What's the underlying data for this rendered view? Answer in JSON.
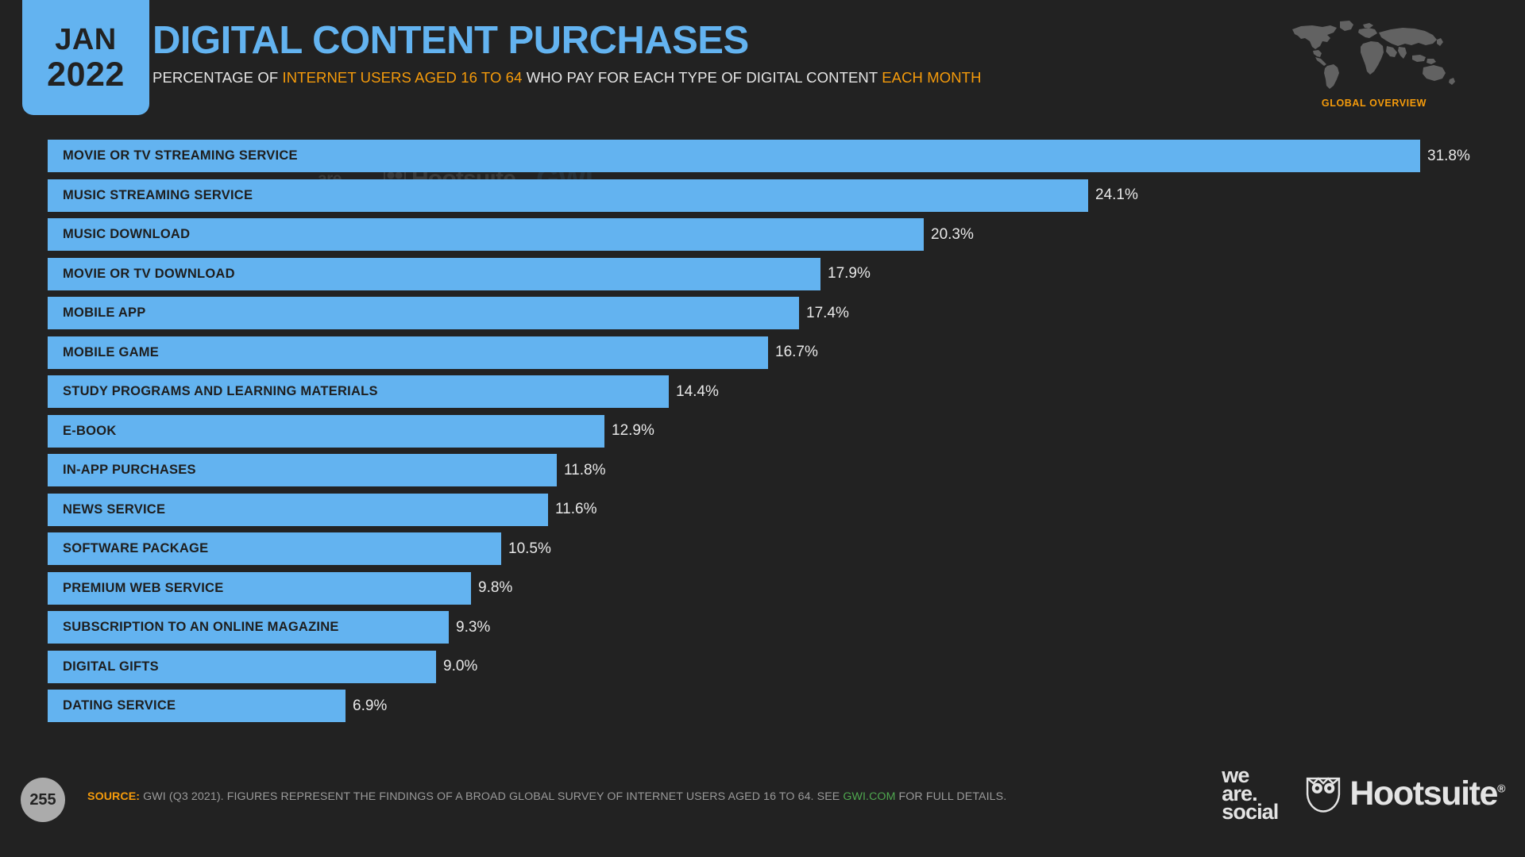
{
  "header": {
    "date_month": "JAN",
    "date_year": "2022",
    "title": "DIGITAL CONTENT PURCHASES",
    "subtitle_parts": [
      {
        "text": "PERCENTAGE OF ",
        "highlight": false
      },
      {
        "text": "INTERNET USERS AGED 16 TO 64",
        "highlight": true
      },
      {
        "text": " WHO PAY FOR EACH TYPE OF DIGITAL CONTENT ",
        "highlight": false
      },
      {
        "text": "EACH MONTH",
        "highlight": true
      }
    ],
    "global_overview_label": "GLOBAL OVERVIEW",
    "accent_blue": "#63B3F0",
    "accent_orange": "#F59B0B",
    "background": "#222222"
  },
  "watermarks": {
    "we_are_social": "we\nare.\nsocial",
    "hootsuite": "Hootsuite",
    "gwi": "GWI."
  },
  "chart_data": {
    "type": "bar",
    "orientation": "horizontal",
    "title": "DIGITAL CONTENT PURCHASES",
    "subtitle": "PERCENTAGE OF INTERNET USERS AGED 16 TO 64 WHO PAY FOR EACH TYPE OF DIGITAL CONTENT EACH MONTH",
    "xlabel": "",
    "ylabel": "",
    "xlim": [
      0,
      31.8
    ],
    "grid": false,
    "legend": false,
    "bar_color": "#63B3F0",
    "categories": [
      "MOVIE OR TV STREAMING SERVICE",
      "MUSIC STREAMING SERVICE",
      "MUSIC DOWNLOAD",
      "MOVIE OR TV DOWNLOAD",
      "MOBILE APP",
      "MOBILE GAME",
      "STUDY PROGRAMS AND LEARNING MATERIALS",
      "E-BOOK",
      "IN-APP PURCHASES",
      "NEWS SERVICE",
      "SOFTWARE PACKAGE",
      "PREMIUM WEB SERVICE",
      "SUBSCRIPTION TO AN ONLINE MAGAZINE",
      "DIGITAL GIFTS",
      "DATING SERVICE"
    ],
    "values": [
      31.8,
      24.1,
      20.3,
      17.9,
      17.4,
      16.7,
      14.4,
      12.9,
      11.8,
      11.6,
      10.5,
      9.8,
      9.3,
      9.0,
      6.9
    ],
    "value_labels": [
      "31.8%",
      "24.1%",
      "20.3%",
      "17.9%",
      "17.4%",
      "16.7%",
      "14.4%",
      "12.9%",
      "11.8%",
      "11.6%",
      "10.5%",
      "9.8%",
      "9.3%",
      "9.0%",
      "6.9%"
    ]
  },
  "footer": {
    "page_number": "255",
    "source_label": "SOURCE:",
    "source_text_before": " GWI (Q3 2021). FIGURES REPRESENT THE FINDINGS OF A BROAD GLOBAL SURVEY OF INTERNET USERS AGED 16 TO 64. SEE ",
    "source_link": "GWI.COM",
    "source_text_after": " FOR FULL DETAILS.",
    "logo_we_are_social": "we\nare.\nsocial",
    "logo_hootsuite": "Hootsuite",
    "logo_hootsuite_reg": "®"
  }
}
